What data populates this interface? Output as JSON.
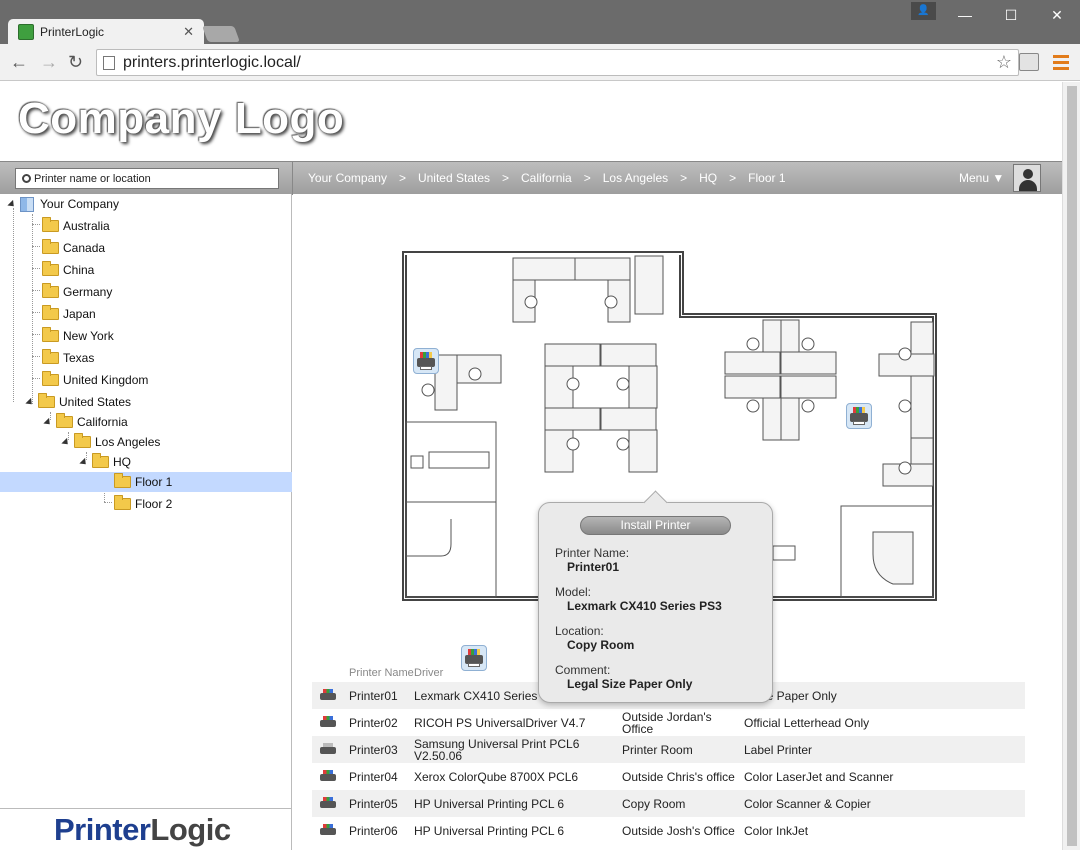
{
  "browser": {
    "tab_title": "PrinterLogic",
    "url": "printers.printerlogic.local/"
  },
  "header": {
    "logo_text": "Company Logo"
  },
  "search": {
    "placeholder": "Printer name or location"
  },
  "breadcrumb": {
    "items": [
      "Your Company",
      "United States",
      "California",
      "Los Angeles",
      "HQ",
      "Floor 1"
    ],
    "separator": ">"
  },
  "menu": {
    "label": "Menu ▼"
  },
  "tree": {
    "root": "Your Company",
    "countries": [
      "Australia",
      "Canada",
      "China",
      "Germany",
      "Japan",
      "New York",
      "Texas",
      "United Kingdom",
      "United States"
    ],
    "state": "California",
    "city": "Los Angeles",
    "building": "HQ",
    "floors": [
      "Floor 1",
      "Floor 2"
    ],
    "selected": "Floor 1"
  },
  "brand": {
    "part1": "Printer",
    "part2": "Logic"
  },
  "popup": {
    "install_label": "Install Printer",
    "name_label": "Printer Name:",
    "name_value": "Printer01",
    "model_label": "Model:",
    "model_value": "Lexmark CX410 Series PS3",
    "location_label": "Location:",
    "location_value": "Copy Room",
    "comment_label": "Comment:",
    "comment_value": "Legal Size Paper Only"
  },
  "table": {
    "headers": [
      "Printer Name",
      "Driver",
      "",
      "ment"
    ],
    "rows": [
      {
        "name": "Printer01",
        "driver": "Lexmark CX410 Series",
        "location": "",
        "comment": "l Size Paper Only",
        "color": true
      },
      {
        "name": "Printer02",
        "driver": "RICOH PS UniversalDriver V4.7",
        "location": "Outside Jordan's Office",
        "comment": "Official Letterhead Only",
        "color": true
      },
      {
        "name": "Printer03",
        "driver": "Samsung Universal Print PCL6 V2.50.06",
        "location": "Printer Room",
        "comment": "Label Printer",
        "color": false
      },
      {
        "name": "Printer04",
        "driver": "Xerox ColorQube 8700X PCL6",
        "location": "Outside Chris's office",
        "comment": "Color LaserJet and Scanner",
        "color": true
      },
      {
        "name": "Printer05",
        "driver": "HP Universal Printing PCL 6",
        "location": "Copy Room",
        "comment": "Color Scanner & Copier",
        "color": true
      },
      {
        "name": "Printer06",
        "driver": "HP Universal Printing PCL 6",
        "location": "Outside Josh's Office",
        "comment": "Color InkJet",
        "color": true
      }
    ]
  }
}
